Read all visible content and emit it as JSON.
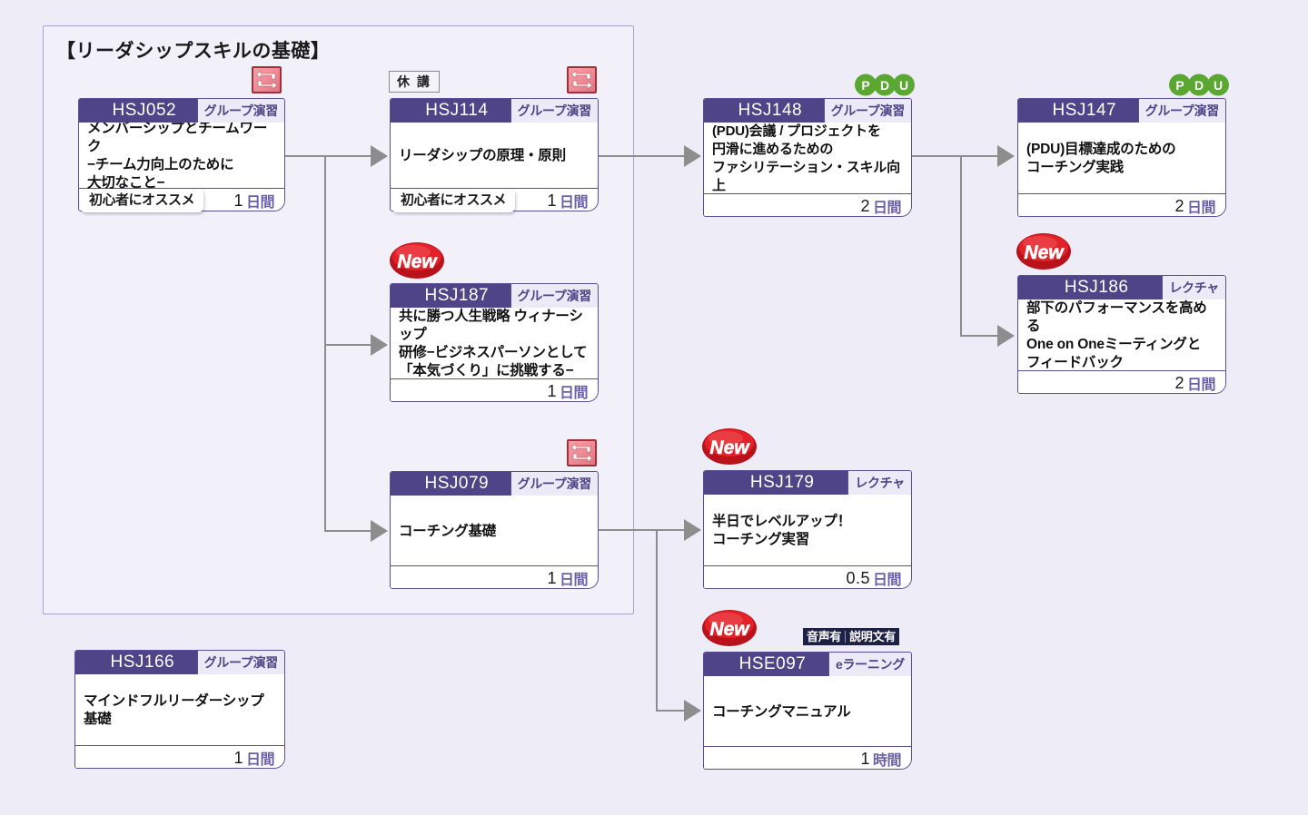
{
  "diagram": {
    "title": "【リーダシップスキルの基礎】",
    "background_color": "#eeecf6",
    "accent_color": "#4e4487"
  },
  "labels": {
    "kyuko": "休 講",
    "recommend": "初心者にオススメ",
    "media_audio": "音声有",
    "media_text": "説明文有",
    "new": "New",
    "pdu": "PDU"
  },
  "courses": [
    {
      "id": "hsj052",
      "code": "HSJ052",
      "type": "グループ演習",
      "title": "メンバーシップとチームワーク\n−チーム力向上のために\n大切なこと−",
      "duration_num": "1",
      "duration_unit": "日間"
    },
    {
      "id": "hsj114",
      "code": "HSJ114",
      "type": "グループ演習",
      "title": "リーダシップの原理・原則",
      "duration_num": "1",
      "duration_unit": "日間"
    },
    {
      "id": "hsj187",
      "code": "HSJ187",
      "type": "グループ演習",
      "title": "共に勝つ人生戦略 ウィナーシップ\n研修−ビジネスパーソンとして\n「本気づくり」に挑戦する−",
      "duration_num": "1",
      "duration_unit": "日間"
    },
    {
      "id": "hsj079",
      "code": "HSJ079",
      "type": "グループ演習",
      "title": "コーチング基礎",
      "duration_num": "1",
      "duration_unit": "日間"
    },
    {
      "id": "hsj148",
      "code": "HSJ148",
      "type": "グループ演習",
      "title": "(PDU)会議 / プロジェクトを\n円滑に進めるための\nファシリテーション・スキル向上",
      "duration_num": "2",
      "duration_unit": "日間"
    },
    {
      "id": "hsj147",
      "code": "HSJ147",
      "type": "グループ演習",
      "title": "(PDU)目標達成のための\nコーチング実践",
      "duration_num": "2",
      "duration_unit": "日間"
    },
    {
      "id": "hsj186",
      "code": "HSJ186",
      "type": "レクチャ",
      "title": "部下のパフォーマンスを高める\nOne on Oneミーティングと\nフィードバック",
      "duration_num": "2",
      "duration_unit": "日間"
    },
    {
      "id": "hsj179",
      "code": "HSJ179",
      "type": "レクチャ",
      "title": "半日でレベルアップ！\nコーチング実習",
      "duration_num": "0.5",
      "duration_unit": "日間"
    },
    {
      "id": "hse097",
      "code": "HSE097",
      "type": "eラーニング",
      "title": "コーチングマニュアル",
      "duration_num": "1",
      "duration_unit": "時間"
    },
    {
      "id": "hsj166",
      "code": "HSJ166",
      "type": "グループ演習",
      "title": "マインドフルリーダーシップ\n基礎",
      "duration_num": "1",
      "duration_unit": "日間"
    }
  ]
}
